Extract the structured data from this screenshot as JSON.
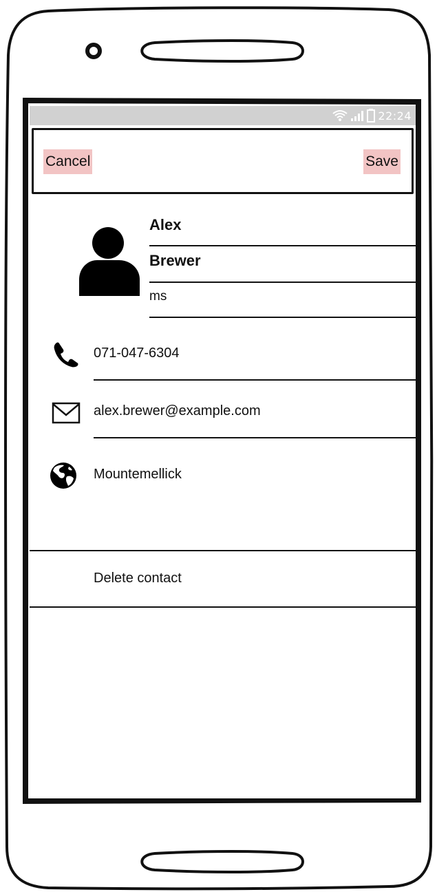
{
  "status_bar": {
    "time": "22:24",
    "icons": [
      "wifi-icon",
      "signal-icon",
      "battery-icon"
    ]
  },
  "toolbar": {
    "cancel_label": "Cancel",
    "save_label": "Save",
    "button_highlight_color": "#f2c4c4"
  },
  "contact": {
    "first_name": "Alex",
    "last_name": "Brewer",
    "prefix": "ms",
    "phone": "071-047-6304",
    "email": "alex.brewer@example.com",
    "location": "Mountemellick"
  },
  "actions": {
    "delete_label": "Delete contact"
  },
  "icons": {
    "avatar": "person-icon",
    "phone": "phone-icon",
    "email": "envelope-icon",
    "location": "globe-icon"
  }
}
